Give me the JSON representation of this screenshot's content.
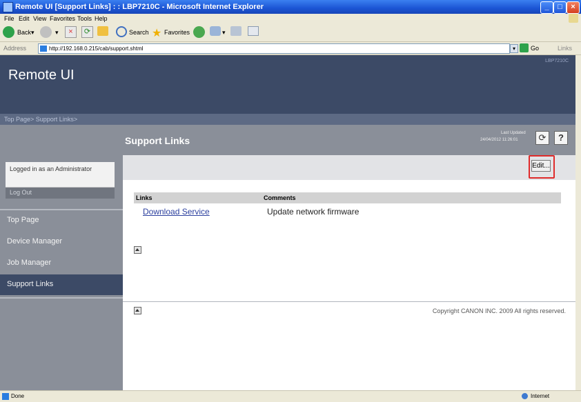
{
  "window": {
    "title": "Remote UI [Support Links] : : LBP7210C - Microsoft Internet Explorer"
  },
  "menubar": {
    "items": [
      "File",
      "Edit",
      "View",
      "Favorites",
      "Tools",
      "Help"
    ]
  },
  "toolbar": {
    "back": "Back",
    "search": "Search",
    "favorites": "Favorites"
  },
  "addressbar": {
    "label": "Address",
    "url": "http://192.168.0.215/cab/support.shtml",
    "go": "Go",
    "links": "Links"
  },
  "brand": {
    "title": "Remote UI",
    "model": "LBP7210C"
  },
  "breadcrumb": "Top Page> Support Links>",
  "page": {
    "title": "Support Links",
    "last_updated_label": "Last Updated",
    "last_updated_value": "24/04/2012 11:26:01",
    "refresh": "⟳",
    "help": "?",
    "edit": "Edit..."
  },
  "login": {
    "status": "Logged in as an Administrator",
    "logout": "Log Out"
  },
  "nav": {
    "items": [
      "Top Page",
      "Device Manager",
      "Job Manager",
      "Support Links"
    ],
    "selected": "Support Links"
  },
  "table": {
    "headers": [
      "Links",
      "Comments"
    ],
    "rows": [
      {
        "link": "Download Service",
        "comment": "Update network firmware"
      }
    ]
  },
  "footer": {
    "copyright": "Copyright CANON INC. 2009 All rights reserved."
  },
  "status": {
    "left": "Done",
    "zone": "Internet"
  },
  "colors": {
    "header": "#3c4a66",
    "nav": "#8a8f99",
    "selected_nav": "#3c4a66",
    "edit_highlight": "#e02a2a"
  }
}
